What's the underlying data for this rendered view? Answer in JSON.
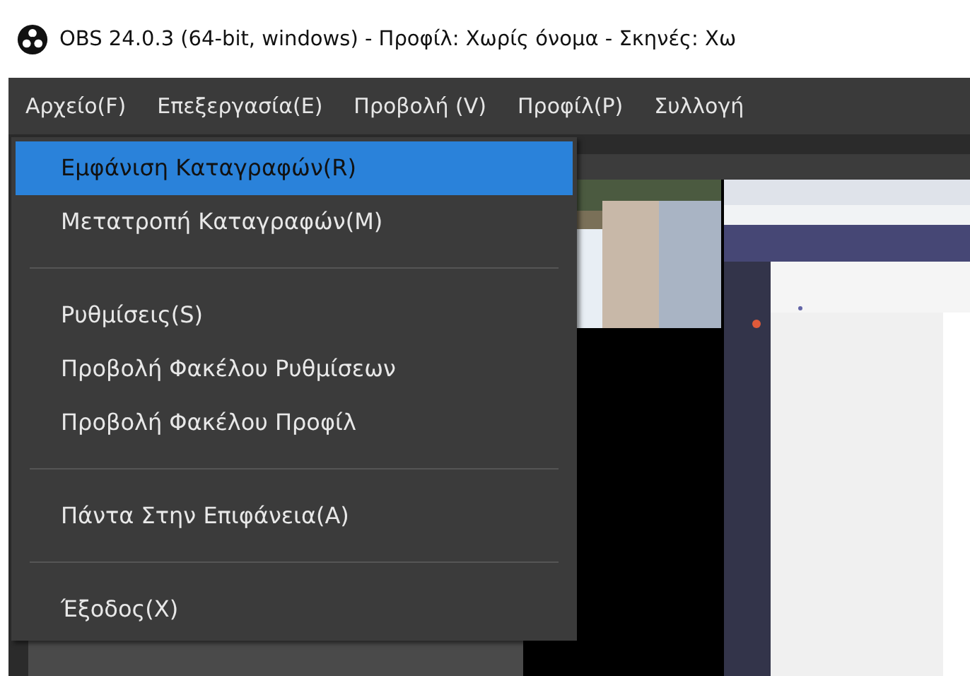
{
  "window": {
    "title": "OBS 24.0.3 (64-bit, windows) - Προφίλ: Χωρίς όνομα - Σκηνές: Χω"
  },
  "menu_bar": [
    {
      "label": "Αρχείο(F)"
    },
    {
      "label": "Επεξεργασία(E)"
    },
    {
      "label": "Προβολή (V)"
    },
    {
      "label": "Προφίλ(P)"
    },
    {
      "label": "Συλλογή"
    }
  ],
  "file_menu": {
    "items": [
      {
        "kind": "item",
        "label": "Εμφάνιση Καταγραφών(R)",
        "selected": true
      },
      {
        "kind": "item",
        "label": "Μετατροπή Καταγραφών(M)",
        "selected": false
      },
      {
        "kind": "separator"
      },
      {
        "kind": "item",
        "label": "Ρυθμίσεις(S)",
        "selected": false
      },
      {
        "kind": "item",
        "label": "Προβολή Φακέλου Ρυθμίσεων",
        "selected": false
      },
      {
        "kind": "item",
        "label": "Προβολή Φακέλου Προφίλ",
        "selected": false
      },
      {
        "kind": "separator"
      },
      {
        "kind": "item",
        "label": "Πάντα Στην Επιφάνεια(A)",
        "selected": false
      },
      {
        "kind": "separator"
      },
      {
        "kind": "item",
        "label": "Έξοδος(X)",
        "selected": false
      }
    ]
  }
}
